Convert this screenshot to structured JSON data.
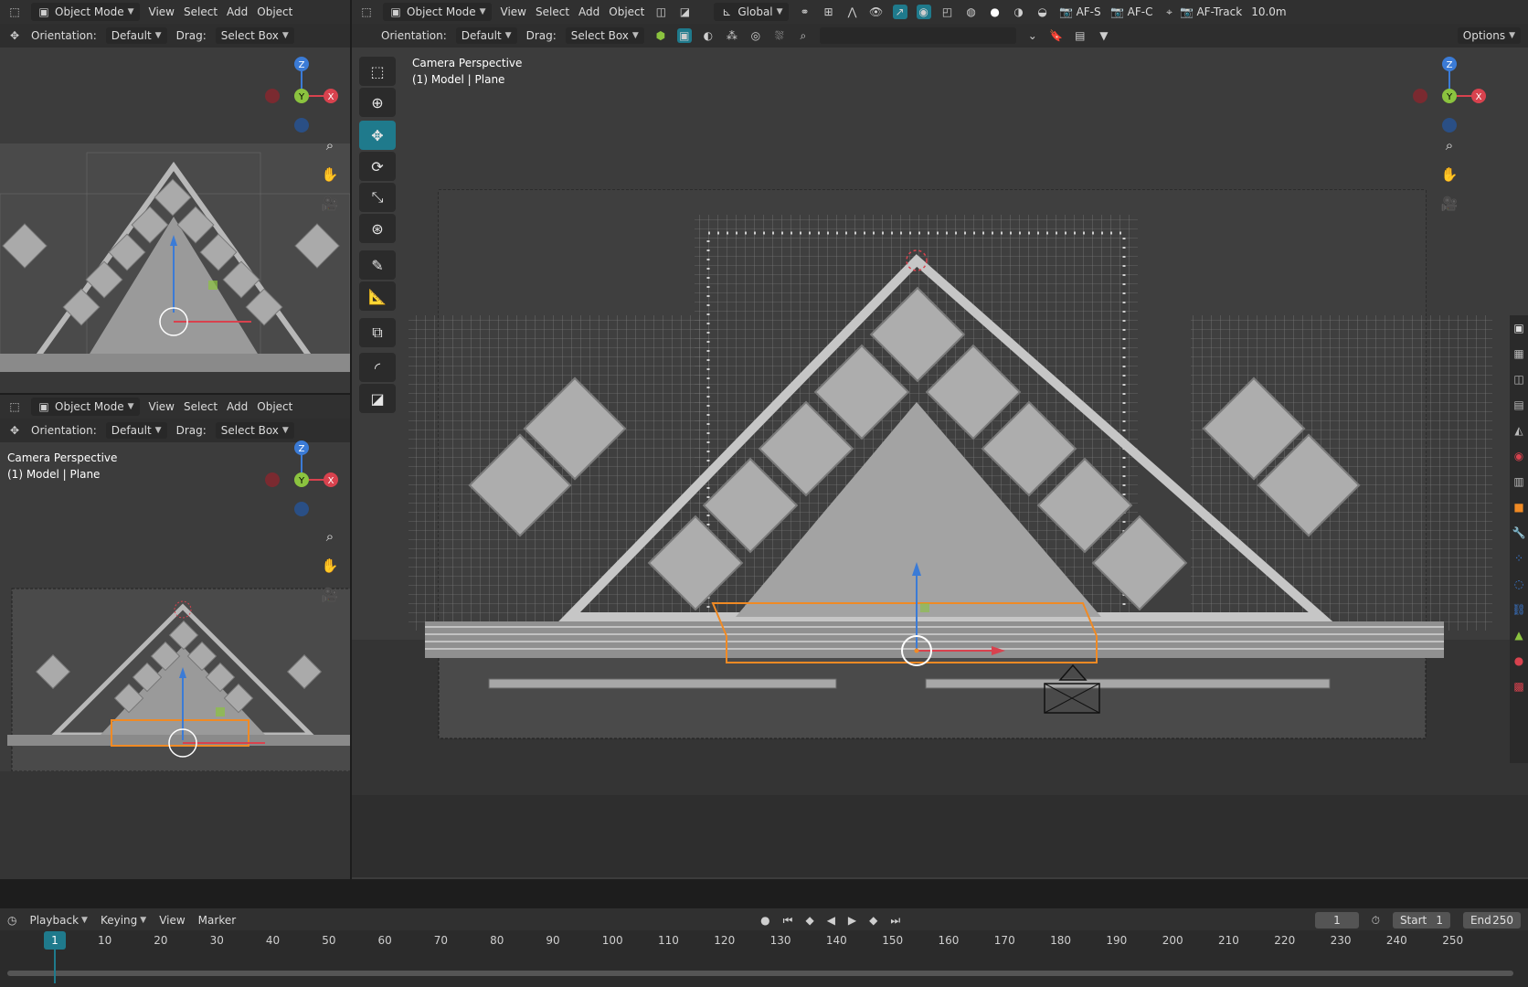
{
  "colors": {
    "accent": "#1f7a8c",
    "axis_x": "#d8424e",
    "axis_y": "#8bc33f",
    "axis_z": "#3b7bd6",
    "selection": "#f08a24"
  },
  "left_top": {
    "header": {
      "mode": "Object Mode",
      "menu": [
        "View",
        "Select",
        "Add",
        "Object"
      ]
    },
    "subheader": {
      "orientation_label": "Orientation:",
      "orientation_value": "Default",
      "drag_label": "Drag:",
      "drag_value": "Select Box"
    }
  },
  "left_bottom": {
    "header": {
      "mode": "Object Mode",
      "menu": [
        "View",
        "Select",
        "Add",
        "Object"
      ]
    },
    "subheader": {
      "orientation_label": "Orientation:",
      "orientation_value": "Default",
      "drag_label": "Drag:",
      "drag_value": "Select Box"
    },
    "overlay": {
      "line1": "Camera Perspective",
      "line2": "(1) Model | Plane"
    }
  },
  "main": {
    "header": {
      "mode": "Object Mode",
      "menu": [
        "View",
        "Select",
        "Add",
        "Object"
      ],
      "transform": "Global",
      "af_s": "AF-S",
      "af_c": "AF-C",
      "af_track": "AF-Track",
      "distance": "10.0m"
    },
    "subheader": {
      "orientation_label": "Orientation:",
      "orientation_value": "Default",
      "drag_label": "Drag:",
      "drag_value": "Select Box",
      "options": "Options"
    },
    "overlay": {
      "line1": "Camera Perspective",
      "line2": "(1) Model | Plane"
    },
    "gizmo": {
      "z": "Z",
      "y": "Y",
      "x": "X"
    }
  },
  "timeline": {
    "menu": [
      "Playback",
      "Keying",
      "View",
      "Marker"
    ],
    "current_frame": "1",
    "start_label": "Start",
    "start_value": "1",
    "end_label": "End",
    "end_value": "250",
    "ticks": [
      "1",
      "10",
      "20",
      "30",
      "40",
      "50",
      "60",
      "70",
      "80",
      "90",
      "100",
      "110",
      "120",
      "130",
      "140",
      "150",
      "160",
      "170",
      "180",
      "190",
      "200",
      "210",
      "220",
      "230",
      "240",
      "250"
    ]
  },
  "toolbar": [
    "select-box-tool",
    "cursor-tool",
    "move-tool",
    "rotate-tool",
    "scale-tool",
    "transform-tool",
    "annotate-tool",
    "measure-tool",
    "add-cube-tool",
    "shear-tool",
    "extrude-tool"
  ]
}
